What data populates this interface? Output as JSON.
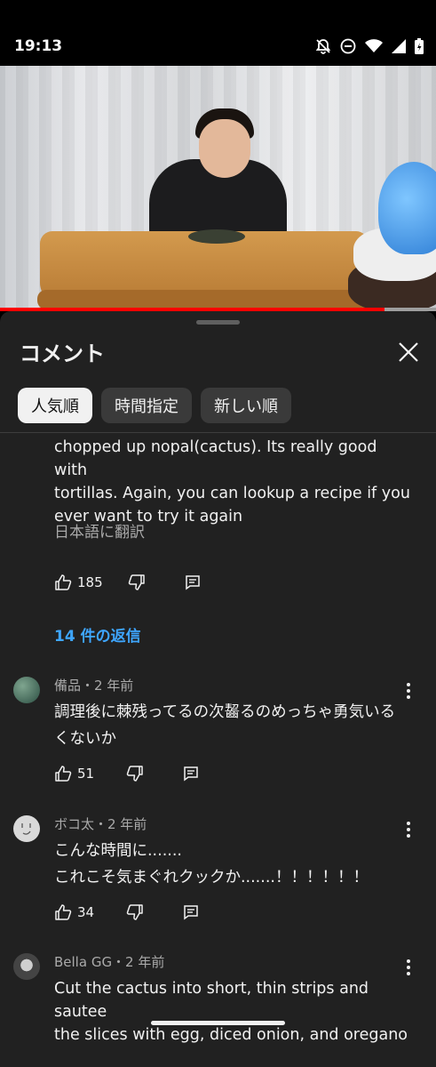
{
  "status_bar": {
    "time": "19:13"
  },
  "video": {
    "progress_fraction": 0.882
  },
  "panel": {
    "title": "コメント",
    "chips": [
      "人気順",
      "時間指定",
      "新しい順"
    ],
    "active_chip": "人気順"
  },
  "first_comment": {
    "text_lines": [
      "chopped up nopal(cactus). Its really good with",
      "tortillas. Again, you can lookup a recipe if you",
      "ever want to try it again"
    ],
    "translate_label": "日本語に翻訳",
    "like_count": "185",
    "replies_label": "14 件の返信"
  },
  "comments": [
    {
      "author_meta": "備品・2 年前",
      "text_lines": [
        "調理後に棘残ってるの次齧るのめっちゃ勇気いる",
        "くないか"
      ],
      "like_count": "51",
      "avatar_color": "#3e6b5a"
    },
    {
      "author_meta": "ボコ太・2 年前",
      "text_lines": [
        "こんな時間に.......",
        "これこそ気まぐれクックか.......！！！！！！"
      ],
      "like_count": "34",
      "avatar_color": "#d9d9d9"
    },
    {
      "author_meta": "Bella GG・2 年前",
      "text_lines": [
        "Cut the cactus into short, thin strips and sautee",
        "the slices with egg, diced onion, and oregano"
      ],
      "like_count": "",
      "avatar_color": "#555555"
    }
  ],
  "colors": {
    "accent_link": "#3ea6ff",
    "progress": "#ff0000",
    "panel_bg": "#212121"
  }
}
